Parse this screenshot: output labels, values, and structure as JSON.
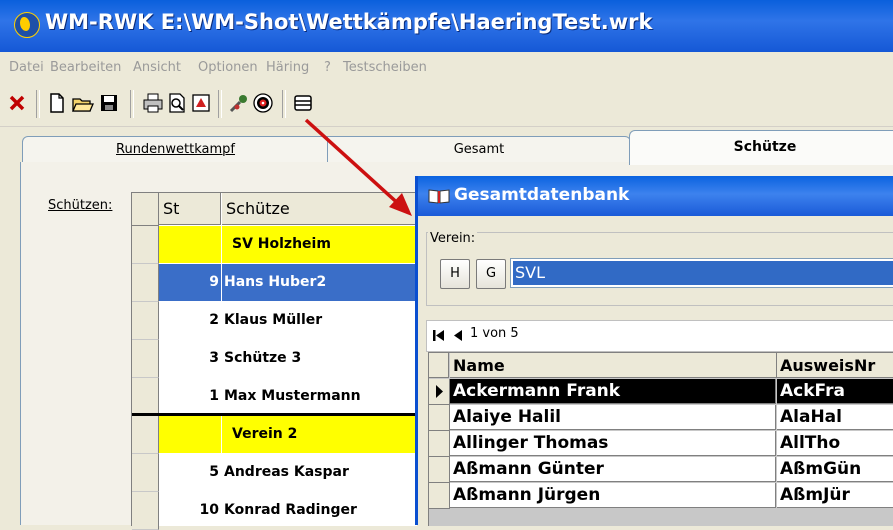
{
  "window": {
    "title": "WM-RWK E:\\WM-Shot\\Wettkämpfe\\HaeringTest.wrk"
  },
  "menu": [
    "Datei",
    "Bearbeiten",
    "Ansicht",
    "Optionen",
    "Häring",
    "?",
    "Testscheiben"
  ],
  "toolbar": {
    "icons": [
      "close-icon",
      "new-file-icon",
      "open-folder-icon",
      "save-icon",
      "print-icon",
      "print-preview-icon",
      "export-icon",
      "tools-icon",
      "target-icon",
      "list-icon"
    ]
  },
  "tabs": [
    "Rundenwettkampf",
    "Gesamt",
    "Schütze"
  ],
  "active_tab": "Schütze",
  "schuetzen_label": "Schützen:",
  "grid": {
    "headers": [
      "St",
      "Schütze"
    ],
    "rows": [
      {
        "st": "",
        "name": "SV Holzheim",
        "type": "club"
      },
      {
        "st": "9",
        "name": "Hans Huber2",
        "type": "selected"
      },
      {
        "st": "2",
        "name": "Klaus Müller",
        "type": "normal"
      },
      {
        "st": "3",
        "name": "Schütze 3",
        "type": "normal"
      },
      {
        "st": "1",
        "name": "Max Mustermann",
        "type": "normal"
      },
      {
        "st": "",
        "name": "Verein 2",
        "type": "club"
      },
      {
        "st": "5",
        "name": "Andreas Kaspar",
        "type": "normal"
      },
      {
        "st": "10",
        "name": "Konrad Radinger",
        "type": "normal"
      }
    ]
  },
  "dialog": {
    "title": "Gesamtdatenbank",
    "verein_label": "Verein:",
    "button_h": "H",
    "button_g": "G",
    "verein_value": "SVL",
    "nav_text": "1 von 5",
    "columns": [
      "Name",
      "AusweisNr"
    ],
    "rows": [
      {
        "name": "Ackermann Frank",
        "nr": "AckFra",
        "current": true
      },
      {
        "name": "Alaiye Halil",
        "nr": "AlaHal",
        "current": false
      },
      {
        "name": "Allinger Thomas",
        "nr": "AllTho",
        "current": false
      },
      {
        "name": "Aßmann Günter",
        "nr": "AßmGün",
        "current": false
      },
      {
        "name": "Aßmann Jürgen",
        "nr": "AßmJür",
        "current": false
      }
    ]
  },
  "colors": {
    "titlebar": "#0a5fdc",
    "club_row": "#ffff00",
    "selected_row": "#3a6ec8",
    "arrow": "#cc1010"
  }
}
